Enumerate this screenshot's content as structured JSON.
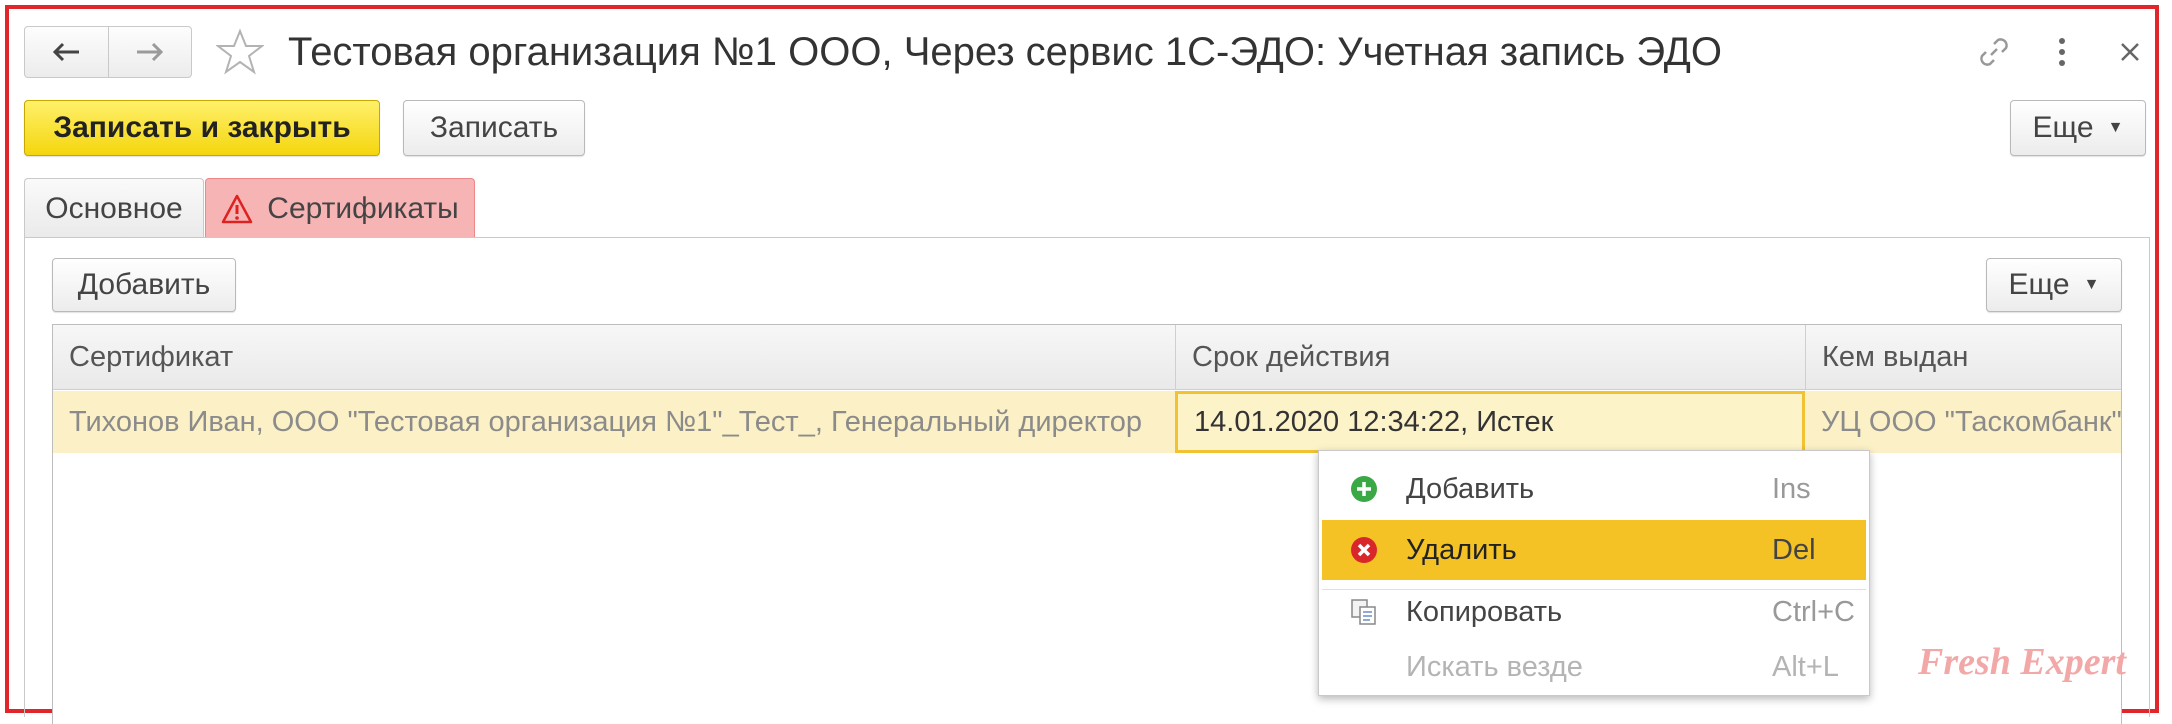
{
  "window": {
    "title": "Тестовая организация №1 ООО, Через сервис 1С-ЭДО: Учетная запись ЭДО"
  },
  "toolbar": {
    "save_close_label": "Записать и закрыть",
    "save_label": "Записать",
    "more_label": "Еще"
  },
  "tabs": [
    {
      "label": "Основное",
      "active": false
    },
    {
      "label": "Сертификаты",
      "active": true,
      "warning": true
    }
  ],
  "certificates": {
    "add_label": "Добавить",
    "more_label": "Еще",
    "columns": [
      "Сертификат",
      "Срок действия",
      "Кем выдан"
    ],
    "rows": [
      {
        "certificate": "Тихонов Иван, ООО \"Тестовая организация №1\"_Тест_, Генеральный директор",
        "validity": "14.01.2020 12:34:22, Истек",
        "issuer": "УЦ ООО \"Таскомбанк\""
      }
    ]
  },
  "context_menu": {
    "items": [
      {
        "label": "Добавить",
        "shortcut": "Ins",
        "icon": "add-circle-icon"
      },
      {
        "label": "Удалить",
        "shortcut": "Del",
        "icon": "delete-circle-icon",
        "selected": true
      },
      {
        "label": "Копировать",
        "shortcut": "Ctrl+C",
        "icon": "copy-icon"
      },
      {
        "label": "Искать везде",
        "shortcut": "Alt+L",
        "disabled": true
      }
    ]
  },
  "watermark": "Fresh Expert",
  "colors": {
    "accent_yellow": "#f4d60e",
    "menu_selected": "#f4c224",
    "row_highlight": "#fbf0c6",
    "warning_tab": "#f7b4b4",
    "frame_red": "#e0262a"
  }
}
